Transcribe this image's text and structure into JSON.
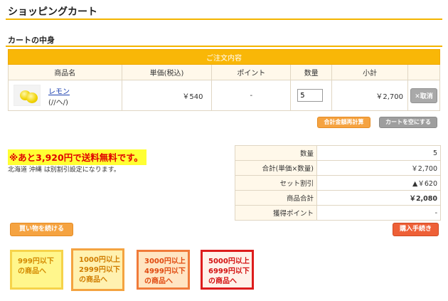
{
  "page": {
    "title": "ショッピングカート"
  },
  "cart": {
    "section_title": "カートの中身",
    "caption": "ご注文内容",
    "headers": {
      "name": "商品名",
      "unit_price": "単価(税込)",
      "point": "ポイント",
      "quantity": "数量",
      "subtotal": "小計"
    },
    "item": {
      "image_icon": "lemon-image",
      "name": "レモン",
      "spec": "(//ヘ/)",
      "unit_price": "￥540",
      "point": "-",
      "quantity": "5",
      "subtotal": "￥2,700",
      "remove_label": "✕取消"
    },
    "recalc_label": "合計金額再計算",
    "empty_label": "カートを空にする"
  },
  "shipping": {
    "promo": "※あと3,920円で送料無料です。",
    "note": "北海道 沖縄 は別割引設定になります。"
  },
  "summary": {
    "rows": [
      {
        "label": "数量",
        "value": "5"
      },
      {
        "label": "合計(単価×数量)",
        "value": "￥2,700"
      },
      {
        "label": "セット割引",
        "value": "▲￥620"
      },
      {
        "label": "商品合計",
        "value": "￥2,080"
      },
      {
        "label": "獲得ポイント",
        "value": "-"
      }
    ]
  },
  "actions": {
    "continue_label": "買い物を続ける",
    "checkout_label": "購入手続き"
  },
  "price_links": [
    {
      "line1": "999円以下",
      "line2": "の商品へ",
      "line3": ""
    },
    {
      "line1": "1000円以上",
      "line2": "2999円以下",
      "line3": "の商品へ"
    },
    {
      "line1": "3000円以上",
      "line2": "4999円以下",
      "line3": "の商品へ"
    },
    {
      "line1": "5000円以上",
      "line2": "6999円以下",
      "line3": "の商品へ"
    }
  ],
  "colors": {
    "accent": "#f9b707",
    "link": "#1a3fb0",
    "promo_text": "#e00000",
    "promo_bg": "#ffff33",
    "checkout": "#ee6037"
  }
}
